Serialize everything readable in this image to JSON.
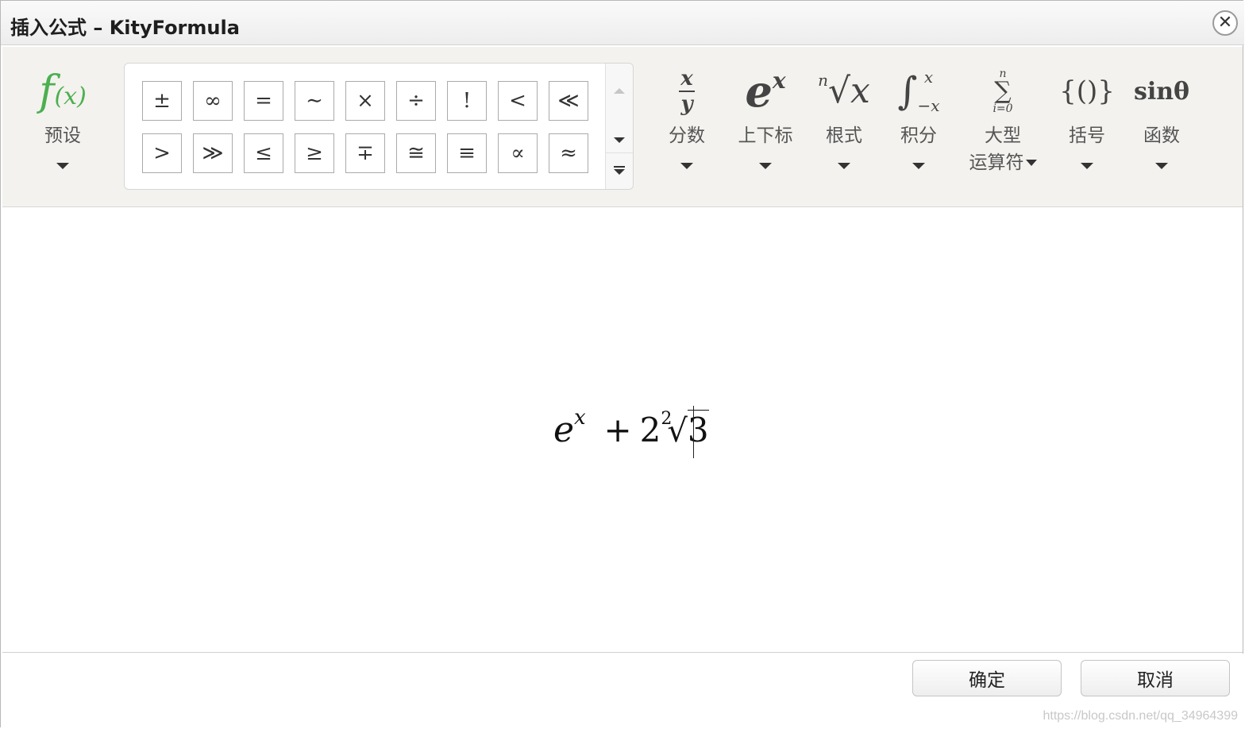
{
  "window": {
    "title": "插入公式 – KityFormula",
    "close_glyph": "✕"
  },
  "toolbar": {
    "preset": {
      "icon": "f(x)",
      "label": "预设"
    },
    "symbols_row1": [
      "±",
      "∞",
      "=",
      "∼",
      "×",
      "÷",
      "!",
      "<",
      "≪"
    ],
    "symbols_row2": [
      ">",
      "≫",
      "≤",
      "≥",
      "∓",
      "≅",
      "≡",
      "∝",
      "≈"
    ],
    "groups": [
      {
        "name": "fraction",
        "label": "分数"
      },
      {
        "name": "script",
        "label": "上下标"
      },
      {
        "name": "radical",
        "label": "根式"
      },
      {
        "name": "integral",
        "label": "积分"
      },
      {
        "name": "large-operator",
        "label": "大型\n运算符"
      },
      {
        "name": "bracket",
        "label": "括号"
      },
      {
        "name": "function",
        "label": "函数"
      }
    ],
    "icons": {
      "fraction_num": "x",
      "fraction_den": "y",
      "script_base": "e",
      "script_sup": "x",
      "radical_index": "n",
      "radical_body": "√x",
      "integral_sign": "∫",
      "integral_upper": "x",
      "integral_lower": "−x",
      "sum_sign": "∑",
      "sum_upper": "n",
      "sum_lower": "i=0",
      "bracket_glyph": "{()}",
      "function_glyph": "sinθ"
    },
    "large_operator_line1": "大型",
    "large_operator_line2": "运算符"
  },
  "editor": {
    "formula": {
      "base": "e",
      "sup": "x",
      "plus": "+",
      "coef": "2",
      "root_index": "2",
      "root_sign": "√",
      "radicand": "3"
    }
  },
  "footer": {
    "ok_label": "确定",
    "cancel_label": "取消",
    "watermark": "https://blog.csdn.net/qq_34964399"
  }
}
